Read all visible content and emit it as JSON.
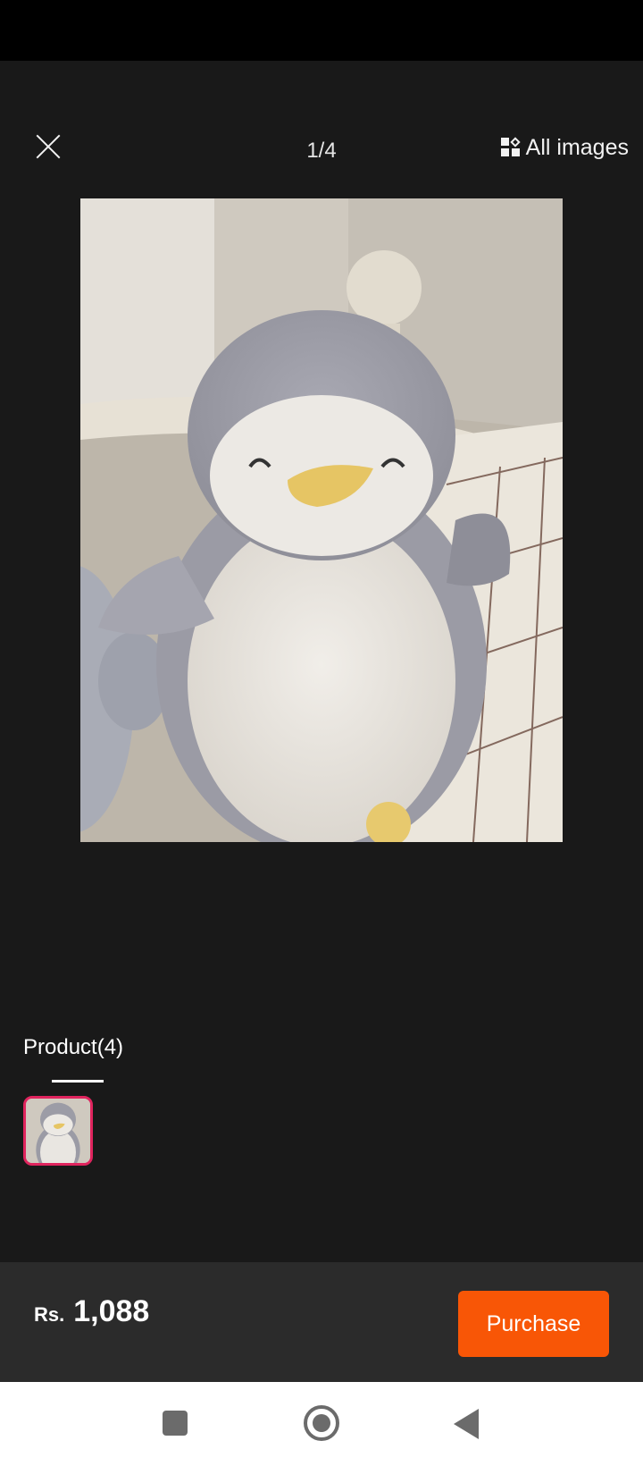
{
  "header": {
    "close_icon": "close-icon",
    "counter": "1/4",
    "all_images_icon": "grid-icon",
    "all_images_label": "All images"
  },
  "photo": {
    "subject": "grey plush penguin toy",
    "colors": {
      "body": "#a3a3ad",
      "belly": "#e9e6e1",
      "beak": "#e9c86a",
      "background": "#c9c4bb"
    }
  },
  "tabs": {
    "product_label": "Product(4)"
  },
  "thumbnails": {
    "selected_index": 0,
    "selected_border": "#e0245e"
  },
  "footer": {
    "currency": "Rs.",
    "price": "1,088",
    "purchase_label": "Purchase",
    "accent": "#f85606"
  },
  "navbar": {
    "recents_icon": "square-icon",
    "home_icon": "home-circle-icon",
    "back_icon": "back-triangle-icon"
  }
}
